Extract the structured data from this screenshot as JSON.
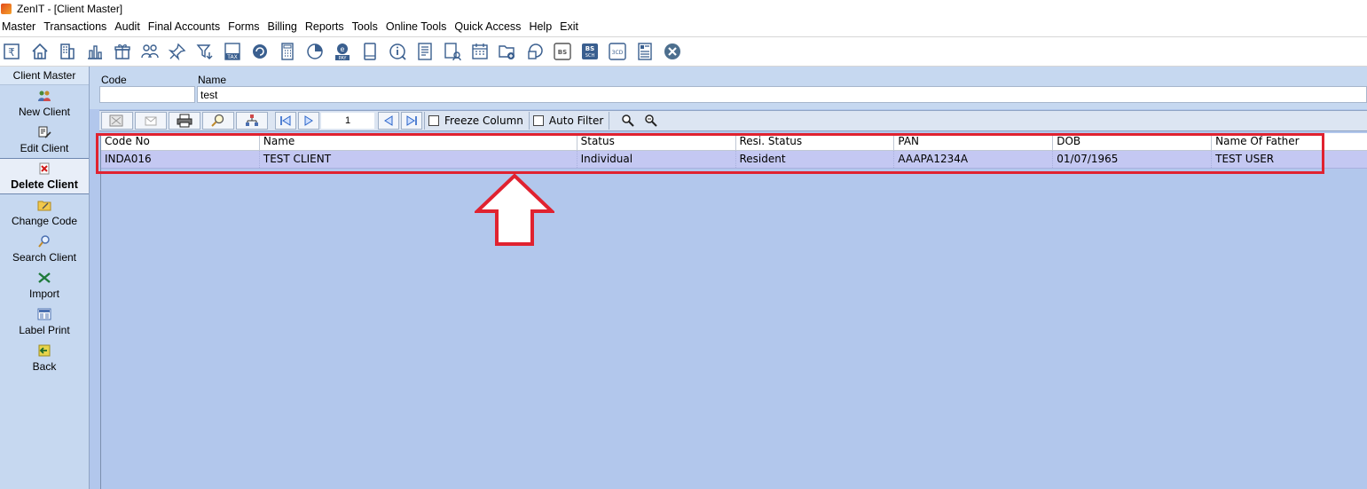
{
  "window": {
    "title": "ZenIT - [Client Master]"
  },
  "menu": {
    "items": [
      "Master",
      "Transactions",
      "Audit",
      "Final Accounts",
      "Forms",
      "Billing",
      "Reports",
      "Tools",
      "Online Tools",
      "Quick Access",
      "Help",
      "Exit"
    ]
  },
  "toolbar": {
    "icons": [
      "rupee-icon",
      "home-icon",
      "building-icon",
      "bar-chart-icon",
      "gift-icon",
      "users-icon",
      "pin-icon",
      "filter-icon",
      "tax-icon",
      "refresh-icon",
      "calculator-icon",
      "pie-chart-icon",
      "epay-icon",
      "book-icon",
      "info-icon",
      "document-icon",
      "user-edit-icon",
      "calendar-icon",
      "folder-add-icon",
      "copy-icon",
      "bs-icon",
      "bs-sch-icon",
      "3cd-icon",
      "form-icon",
      "close-icon"
    ],
    "tax_label": "TAX",
    "pay_label": "PAY",
    "bs_label": "BS",
    "sch_label": "SCH",
    "cd_label": "3CD"
  },
  "left_panel": {
    "title": "Client Master",
    "items": [
      {
        "label": "New Client",
        "icon": "users-icon"
      },
      {
        "label": "Edit Client",
        "icon": "edit-icon"
      },
      {
        "label": "Delete Client",
        "icon": "delete-icon",
        "active": true
      },
      {
        "label": "Change Code",
        "icon": "folder-edit-icon"
      },
      {
        "label": "Search Client",
        "icon": "search-icon"
      },
      {
        "label": "Import",
        "icon": "excel-icon"
      },
      {
        "label": "Label Print",
        "icon": "label-icon"
      },
      {
        "label": "Back",
        "icon": "back-icon"
      }
    ]
  },
  "search": {
    "code_label": "Code",
    "code_value": "",
    "name_label": "Name",
    "name_value": "test"
  },
  "grid_toolbar": {
    "page_number": "1",
    "freeze_column_label": "Freeze Column",
    "freeze_column_checked": false,
    "auto_filter_label": "Auto Filter",
    "auto_filter_checked": false
  },
  "grid": {
    "columns": [
      "Code No",
      "Name",
      "Status",
      "Resi. Status",
      "PAN",
      "DOB",
      "Name Of Father"
    ],
    "rows": [
      [
        "INDA016",
        "TEST CLIENT",
        "Individual",
        "Resident",
        "AAAPA1234A",
        "01/07/1965",
        "TEST USER"
      ]
    ]
  },
  "colors": {
    "annotation": "#e02230",
    "grid_background": "#b2c7ec",
    "selected_row": "#c4c8f2",
    "left_panel": "#c6d8f0"
  }
}
